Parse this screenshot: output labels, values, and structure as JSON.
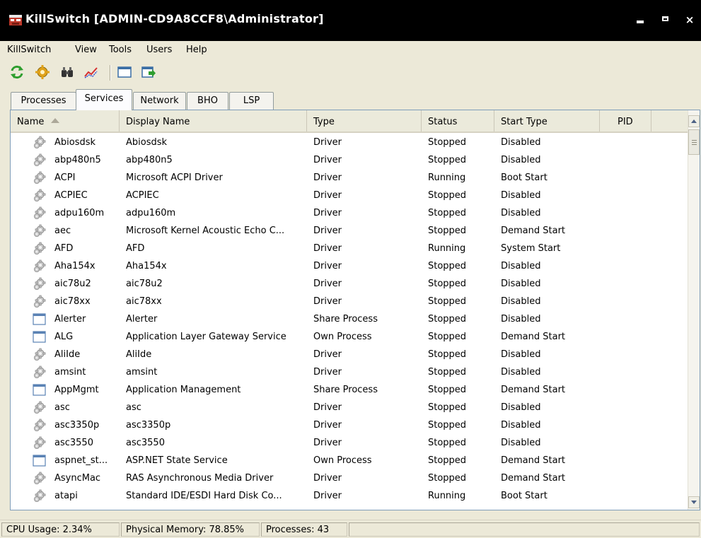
{
  "window": {
    "title": "KillSwitch [ADMIN-CD9A8CCF8\\Administrator]",
    "controls": {
      "minimize": "",
      "maximize": "",
      "close": "×"
    }
  },
  "menu": [
    "KillSwitch",
    "View",
    "Tools",
    "Users",
    "Help"
  ],
  "toolbar": [
    {
      "icon": "refresh-icon"
    },
    {
      "icon": "settings-icon"
    },
    {
      "icon": "find-icon"
    },
    {
      "icon": "graph-icon"
    },
    {
      "icon": "window-icon"
    },
    {
      "icon": "export-icon"
    }
  ],
  "tabs": [
    "Processes",
    "Services",
    "Network",
    "BHO",
    "LSP"
  ],
  "active_tab": "Services",
  "columns": [
    "Name",
    "Display Name",
    "Type",
    "Status",
    "Start Type",
    "PID"
  ],
  "rows": [
    {
      "icon": "gear",
      "name": "Abiosdsk",
      "display": "Abiosdsk",
      "type": "Driver",
      "status": "Stopped",
      "start": "Disabled"
    },
    {
      "icon": "gear",
      "name": "abp480n5",
      "display": "abp480n5",
      "type": "Driver",
      "status": "Stopped",
      "start": "Disabled"
    },
    {
      "icon": "gear",
      "name": "ACPI",
      "display": "Microsoft ACPI Driver",
      "type": "Driver",
      "status": "Running",
      "start": "Boot Start"
    },
    {
      "icon": "gear",
      "name": "ACPIEC",
      "display": "ACPIEC",
      "type": "Driver",
      "status": "Stopped",
      "start": "Disabled"
    },
    {
      "icon": "gear",
      "name": "adpu160m",
      "display": "adpu160m",
      "type": "Driver",
      "status": "Stopped",
      "start": "Disabled"
    },
    {
      "icon": "gear",
      "name": "aec",
      "display": "Microsoft Kernel Acoustic Echo C...",
      "type": "Driver",
      "status": "Stopped",
      "start": "Demand Start"
    },
    {
      "icon": "gear",
      "name": "AFD",
      "display": "AFD",
      "type": "Driver",
      "status": "Running",
      "start": "System Start"
    },
    {
      "icon": "gear",
      "name": "Aha154x",
      "display": "Aha154x",
      "type": "Driver",
      "status": "Stopped",
      "start": "Disabled"
    },
    {
      "icon": "gear",
      "name": "aic78u2",
      "display": "aic78u2",
      "type": "Driver",
      "status": "Stopped",
      "start": "Disabled"
    },
    {
      "icon": "gear",
      "name": "aic78xx",
      "display": "aic78xx",
      "type": "Driver",
      "status": "Stopped",
      "start": "Disabled"
    },
    {
      "icon": "window",
      "name": "Alerter",
      "display": "Alerter",
      "type": "Share Process",
      "status": "Stopped",
      "start": "Disabled"
    },
    {
      "icon": "window",
      "name": "ALG",
      "display": "Application Layer Gateway Service",
      "type": "Own Process",
      "status": "Stopped",
      "start": "Demand Start"
    },
    {
      "icon": "gear",
      "name": "AliIde",
      "display": "AliIde",
      "type": "Driver",
      "status": "Stopped",
      "start": "Disabled"
    },
    {
      "icon": "gear",
      "name": "amsint",
      "display": "amsint",
      "type": "Driver",
      "status": "Stopped",
      "start": "Disabled"
    },
    {
      "icon": "window",
      "name": "AppMgmt",
      "display": "Application Management",
      "type": "Share Process",
      "status": "Stopped",
      "start": "Demand Start"
    },
    {
      "icon": "gear",
      "name": "asc",
      "display": "asc",
      "type": "Driver",
      "status": "Stopped",
      "start": "Disabled"
    },
    {
      "icon": "gear",
      "name": "asc3350p",
      "display": "asc3350p",
      "type": "Driver",
      "status": "Stopped",
      "start": "Disabled"
    },
    {
      "icon": "gear",
      "name": "asc3550",
      "display": "asc3550",
      "type": "Driver",
      "status": "Stopped",
      "start": "Disabled"
    },
    {
      "icon": "window",
      "name": "aspnet_st...",
      "display": "ASP.NET State Service",
      "type": "Own Process",
      "status": "Stopped",
      "start": "Demand Start"
    },
    {
      "icon": "gear",
      "name": "AsyncMac",
      "display": "RAS Asynchronous Media Driver",
      "type": "Driver",
      "status": "Stopped",
      "start": "Demand Start"
    },
    {
      "icon": "gear",
      "name": "atapi",
      "display": "Standard IDE/ESDI Hard Disk Co...",
      "type": "Driver",
      "status": "Running",
      "start": "Boot Start"
    }
  ],
  "status": {
    "cpu": "CPU Usage: 2.34%",
    "memory": "Physical Memory: 78.85%",
    "processes": "Processes: 43"
  }
}
